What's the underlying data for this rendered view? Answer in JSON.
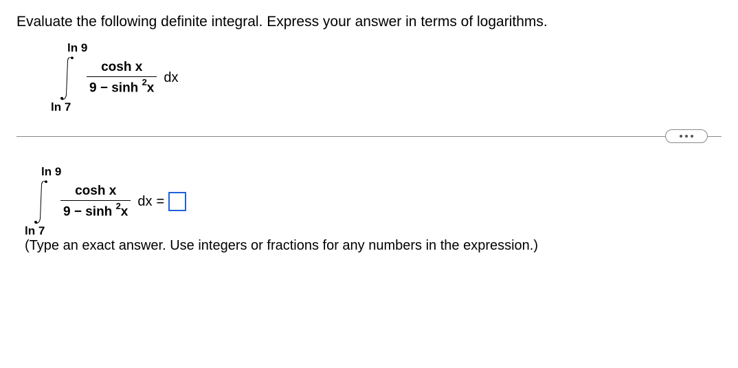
{
  "instruction": "Evaluate the following definite integral. Express your answer in terms of logarithms.",
  "integral": {
    "upper_limit": "ln 9",
    "lower_limit": "ln 7",
    "numerator": "cosh x",
    "denom_before": "9 − sinh",
    "denom_exp": "2",
    "denom_after": "x",
    "dx": "dx"
  },
  "answer_line": {
    "equals": "="
  },
  "hint": "(Type an exact answer. Use integers or fractions for any numbers in the expression.)"
}
